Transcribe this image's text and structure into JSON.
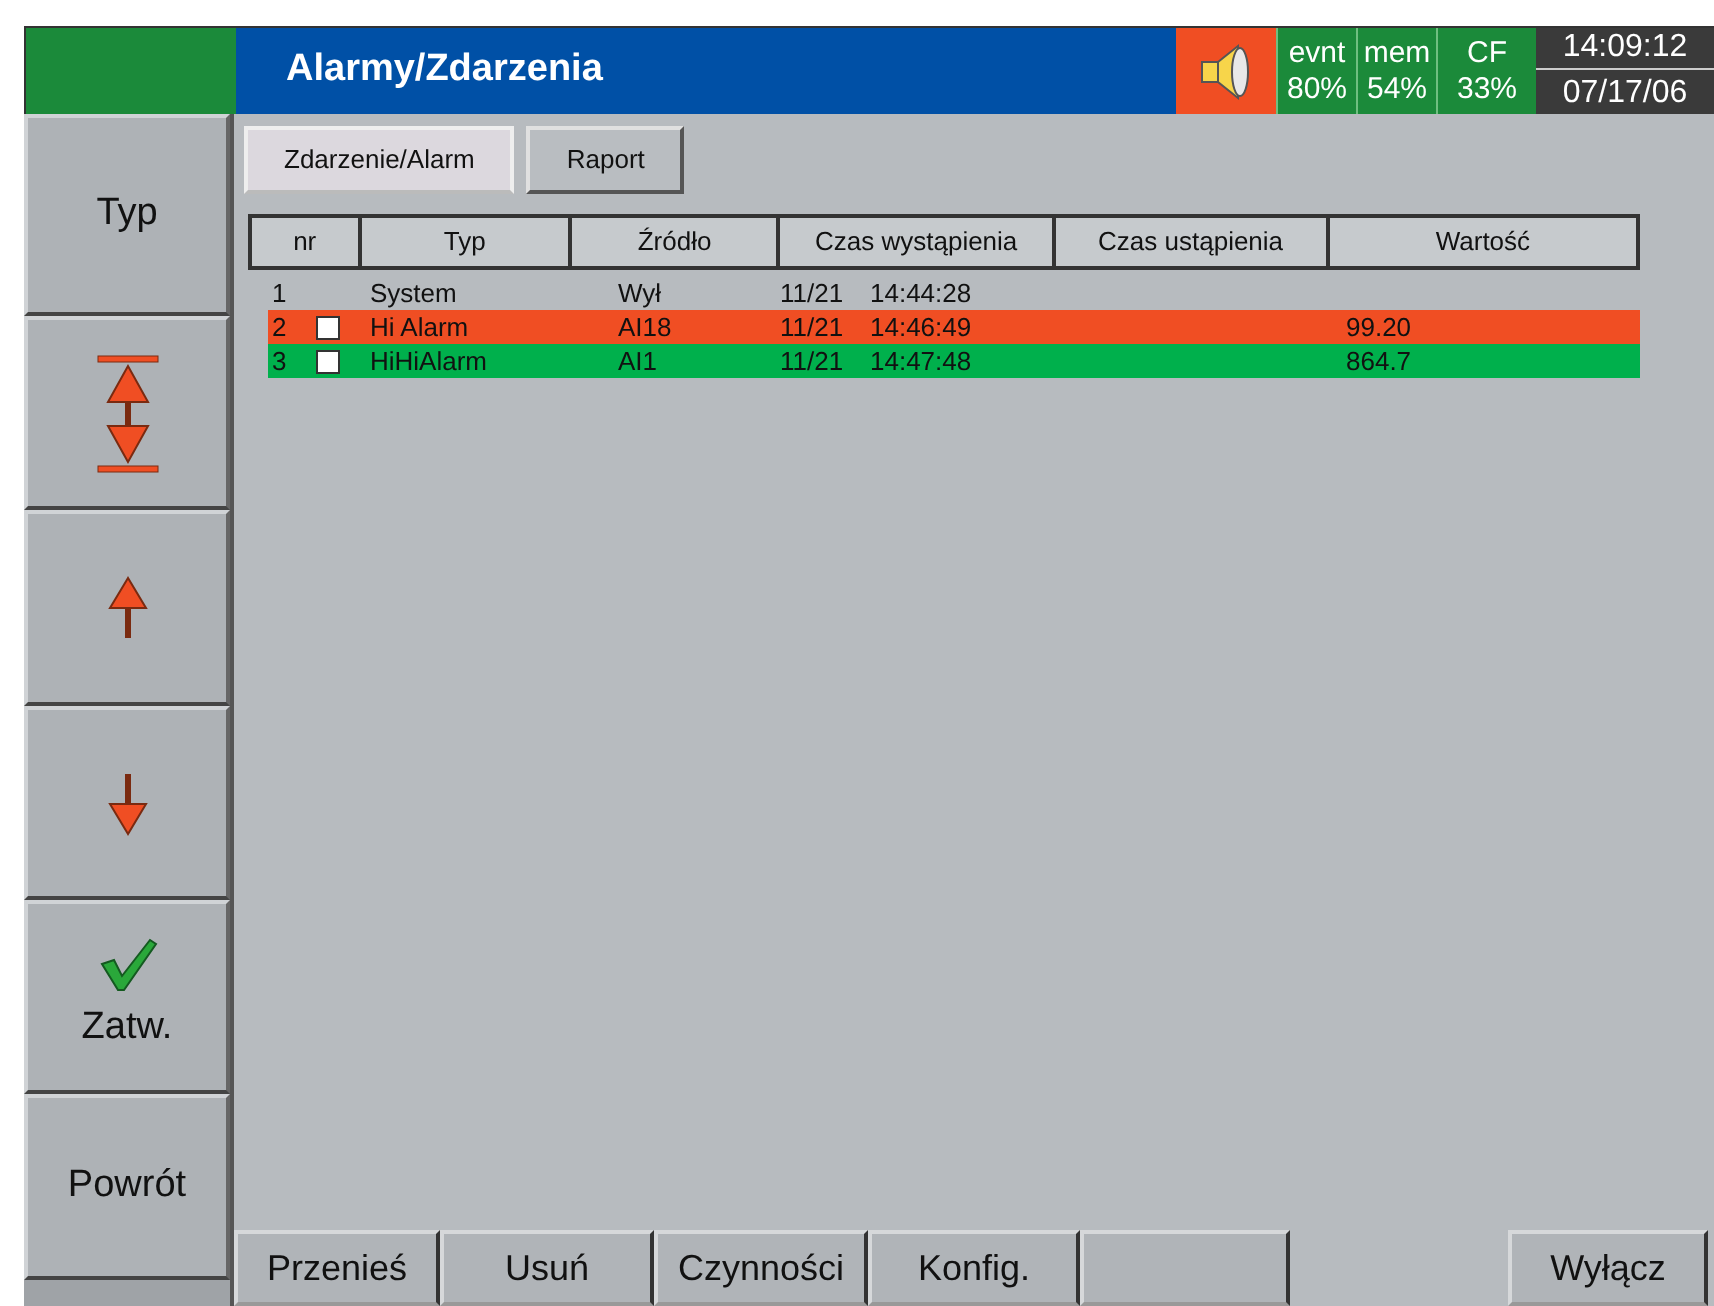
{
  "header": {
    "title": "Alarmy/Zdarzenia",
    "stats": [
      {
        "label": "evnt",
        "value": "80%"
      },
      {
        "label": "mem",
        "value": "54%"
      },
      {
        "label": "CF",
        "value": "33%"
      }
    ],
    "time": "14:09:12",
    "date": "07/17/06"
  },
  "side_buttons": [
    {
      "kind": "text",
      "label": "Typ"
    },
    {
      "kind": "range"
    },
    {
      "kind": "up"
    },
    {
      "kind": "down"
    },
    {
      "kind": "confirm",
      "label": "Zatw."
    },
    {
      "kind": "text",
      "label": "Powrót"
    }
  ],
  "tabs": [
    {
      "label": "Zdarzenie/Alarm",
      "selected": true
    },
    {
      "label": "Raport",
      "selected": false
    }
  ],
  "table": {
    "columns": [
      "nr",
      "Typ",
      "Źródło",
      "Czas wystąpienia",
      "Czas ustąpienia",
      "Wartość"
    ],
    "rows": [
      {
        "kind": "event",
        "nr": "1",
        "type": "System",
        "source": "Wył",
        "date": "11/21",
        "time": "14:44:28"
      },
      {
        "kind": "alarm",
        "checked": false,
        "color": "#f04e23",
        "nr": "2",
        "type": "Hi Alarm",
        "source": "AI18",
        "date": "11/21",
        "time": "14:46:49",
        "value": "99.20"
      },
      {
        "kind": "alarm",
        "checked": false,
        "color": "#00b04c",
        "nr": "3",
        "type": "HiHiAlarm",
        "source": "AI1",
        "date": "11/21",
        "time": "14:47:48",
        "value": "864.7"
      }
    ]
  },
  "bottom_buttons": [
    {
      "kind": "button",
      "label": "Przenieś"
    },
    {
      "kind": "button",
      "label": "Usuń"
    },
    {
      "kind": "button",
      "label": "Czynności"
    },
    {
      "kind": "button",
      "label": "Konfig."
    },
    {
      "kind": "blank"
    },
    {
      "kind": "gap"
    },
    {
      "kind": "button",
      "label": "Wyłącz"
    }
  ]
}
